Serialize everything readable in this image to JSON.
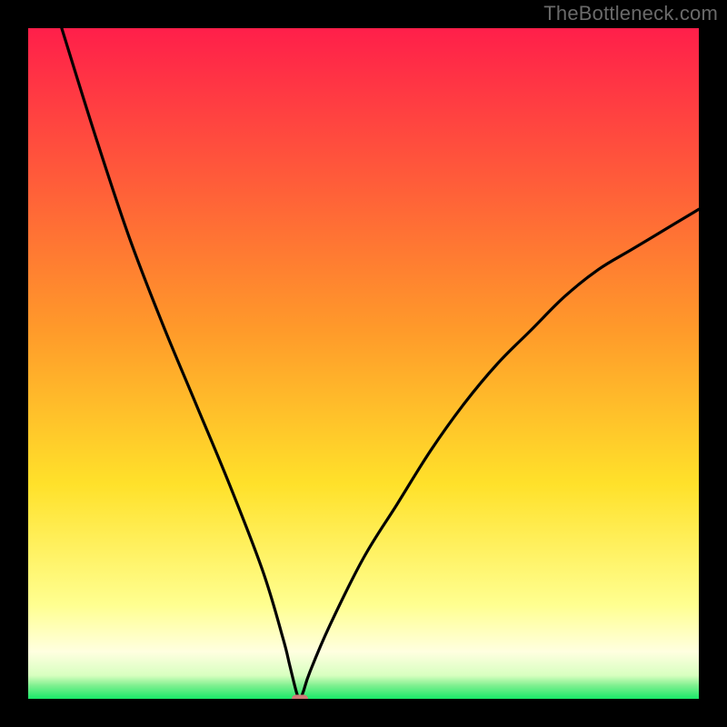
{
  "watermark": {
    "text": "TheBottleneck.com"
  },
  "colors": {
    "frame": "#000000",
    "watermark": "#6a6a6a",
    "curve": "#000000",
    "marker": "#cf7a77",
    "gradient_top": "#ff1f4a",
    "gradient_mid1": "#ff8a2a",
    "gradient_mid2": "#ffe12a",
    "gradient_pale": "#ffffc8",
    "gradient_bottom": "#18f070"
  },
  "chart_data": {
    "type": "line",
    "title": "",
    "xlabel": "",
    "ylabel": "",
    "xlim": [
      0,
      100
    ],
    "ylim": [
      0,
      100
    ],
    "grid": false,
    "legend": false,
    "annotations": [],
    "minimum": {
      "x": 40.5,
      "y": 0
    },
    "series": [
      {
        "name": "curve",
        "x": [
          5,
          10,
          15,
          20,
          25,
          30,
          35,
          38,
          39,
          40,
          40.5,
          41,
          42,
          45,
          50,
          55,
          60,
          65,
          70,
          75,
          80,
          85,
          90,
          95,
          100
        ],
        "y": [
          100,
          84,
          69,
          56,
          44,
          32,
          19,
          9,
          5,
          1,
          0,
          1,
          4,
          11,
          21,
          29,
          37,
          44,
          50,
          55,
          60,
          64,
          67,
          70,
          73
        ]
      }
    ]
  }
}
